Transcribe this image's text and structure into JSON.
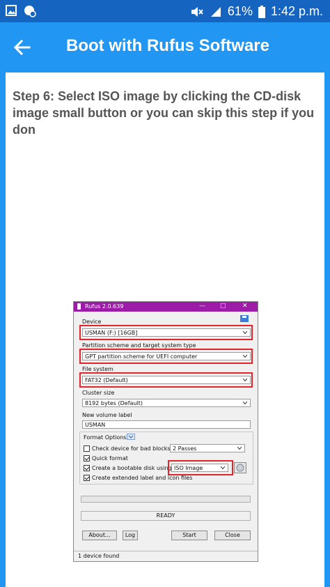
{
  "status_bar": {
    "battery_percent": "61%",
    "time": "1:42 p.m.",
    "icons": [
      "gallery-icon",
      "chat-settings-icon",
      "mute-icon",
      "signal-icon",
      "battery-icon"
    ]
  },
  "app_bar": {
    "title": "Boot with Rufus Software",
    "back_icon": "arrow-left-icon"
  },
  "step_text": "Step 6: Select ISO image by clicking the CD-disk image small button or you can skip this step if you don",
  "rufus": {
    "window_title": "Rufus 2.0.639",
    "device_label": "Device",
    "device_value": "USMAN (F:) [16GB]",
    "partition_label": "Partition scheme and target system type",
    "partition_value": "GPT partition scheme for UEFI computer",
    "filesystem_label": "File system",
    "filesystem_value": "FAT32 (Default)",
    "cluster_label": "Cluster size",
    "cluster_value": "8192 bytes (Default)",
    "volume_label": "New volume label",
    "volume_value": "USMAN",
    "format_options_label": "Format Options",
    "check_bad_blocks_label": "Check device for bad blocks",
    "passes_value": "2 Passes",
    "quick_format_label": "Quick format",
    "bootable_label": "Create a bootable disk using",
    "iso_value": "ISO Image",
    "extended_label": "Create extended label and icon files",
    "ready_text": "READY",
    "about_button": "About...",
    "log_button": "Log",
    "start_button": "Start",
    "close_button": "Close",
    "status_text": "1 device found",
    "highlight_color": "#e3242b",
    "titlebar_color": "#9c1ca8"
  }
}
